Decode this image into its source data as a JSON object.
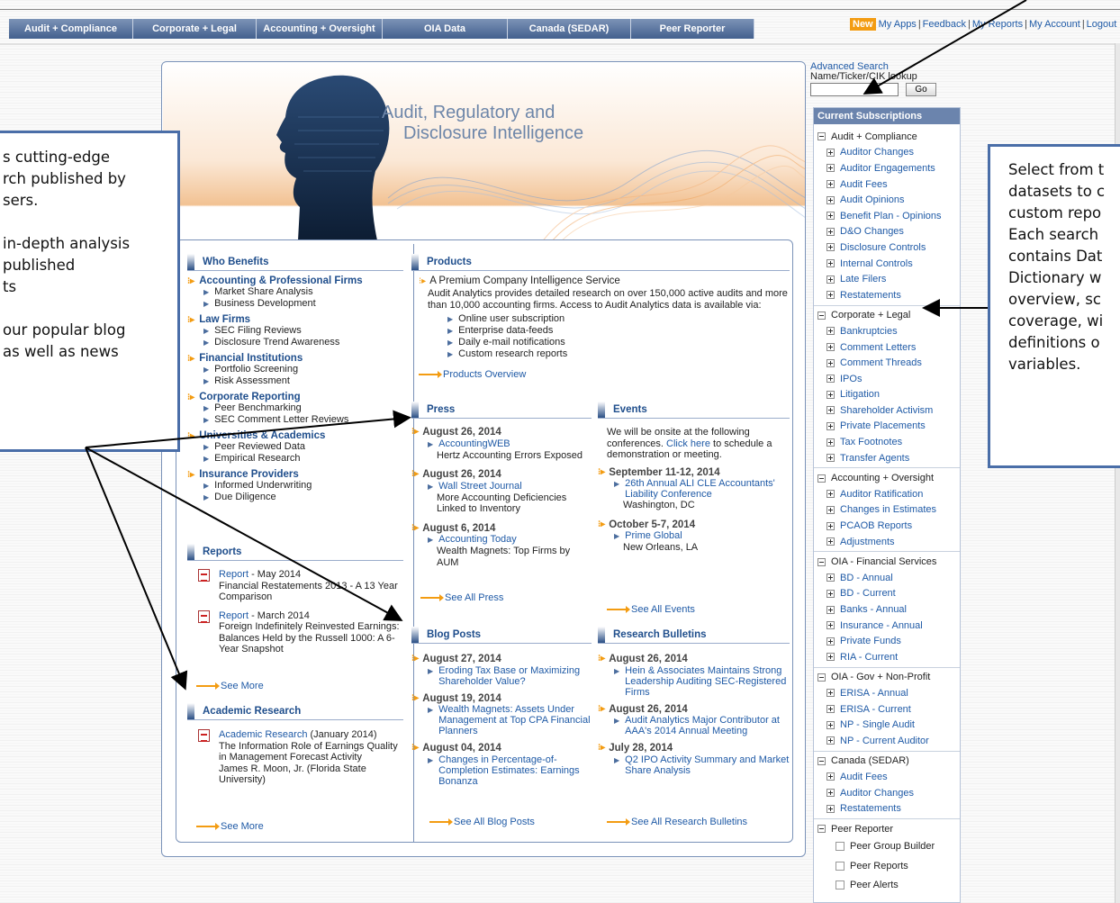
{
  "nav": {
    "tabs": [
      "Audit + Compliance",
      "Corporate + Legal",
      "Accounting + Oversight",
      "OIA Data",
      "Canada (SEDAR)",
      "Peer Reporter"
    ]
  },
  "toplinks": {
    "new_badge": "New",
    "my_apps": "My Apps",
    "feedback": "Feedback",
    "my_reports": "My Reports",
    "my_account": "My Account",
    "logout": "Logout",
    "separator": "|"
  },
  "hero": {
    "title_line1": "Audit, Regulatory and",
    "title_line2": "Disclosure Intelligence"
  },
  "search": {
    "advanced": "Advanced Search",
    "lookup_label": "Name/Ticker/CIK lookup",
    "input_value": "",
    "go": "Go"
  },
  "who_benefits": {
    "heading": "Who Benefits",
    "groups": [
      {
        "title": "Accounting & Professional Firms",
        "items": [
          "Market Share Analysis",
          "Business Development"
        ]
      },
      {
        "title": "Law Firms",
        "items": [
          "SEC Filing Reviews",
          "Disclosure Trend Awareness"
        ]
      },
      {
        "title": "Financial Institutions",
        "items": [
          "Portfolio Screening",
          "Risk Assessment"
        ]
      },
      {
        "title": "Corporate Reporting",
        "items": [
          "Peer Benchmarking",
          "SEC Comment Letter Reviews"
        ]
      },
      {
        "title": "Universities & Academics",
        "items": [
          "Peer Reviewed Data",
          "Empirical Research"
        ]
      },
      {
        "title": "Insurance Providers",
        "items": [
          "Informed Underwriting",
          "Due Diligence"
        ]
      }
    ]
  },
  "reports": {
    "heading": "Reports",
    "items": [
      {
        "link": "Report",
        "date": " - May 2014",
        "desc": "Financial Restatements 2013 - A 13 Year Comparison"
      },
      {
        "link": "Report",
        "date": " - March 2014",
        "desc": "Foreign Indefinitely Reinvested Earnings: Balances Held by the Russell 1000: A 6-Year Snapshot"
      }
    ],
    "see_more": "See More"
  },
  "academic": {
    "heading": "Academic Research",
    "link": "Academic Research",
    "date": " (January 2014)",
    "desc": "The Information Role of Earnings Quality in Management Forecast Activity",
    "author": "James R. Moon, Jr. (Florida State University)",
    "see_more": "See More"
  },
  "products": {
    "heading": "Products",
    "title": "A Premium Company Intelligence Service",
    "desc": "Audit Analytics provides detailed research on over 150,000 active audits and more than 10,000 accounting firms. Access to Audit Analytics data is available via:",
    "items": [
      "Online user subscription",
      "Enterprise data-feeds",
      "Daily e-mail notifications",
      "Custom research reports"
    ],
    "overview": "Products Overview"
  },
  "press": {
    "heading": "Press",
    "items": [
      {
        "date": "August 26, 2014",
        "source": "AccountingWEB",
        "desc": "Hertz Accounting Errors Exposed"
      },
      {
        "date": "August 26, 2014",
        "source": "Wall Street Journal",
        "desc": "More Accounting Deficiencies Linked to Inventory"
      },
      {
        "date": "August 6, 2014",
        "source": "Accounting Today",
        "desc": "Wealth Magnets: Top Firms by AUM"
      }
    ],
    "see_all": "See All Press"
  },
  "events": {
    "heading": "Events",
    "intro_a": "We will be onsite at the following conferences. ",
    "intro_link": "Click here",
    "intro_b": " to schedule a demonstration or meeting.",
    "items": [
      {
        "date": "September 11-12, 2014",
        "name": "26th Annual ALI CLE Accountants' Liability Conference",
        "place": "Washington, DC"
      },
      {
        "date": "October 5-7, 2014",
        "name": "Prime Global",
        "place": "New Orleans, LA"
      }
    ],
    "see_all": "See All Events"
  },
  "blog": {
    "heading": "Blog Posts",
    "items": [
      {
        "date": "August 27, 2014",
        "title": "Eroding Tax Base or Maximizing Shareholder Value?"
      },
      {
        "date": "August 19, 2014",
        "title": "Wealth Magnets: Assets Under Management at Top CPA Financial Planners"
      },
      {
        "date": "August 04, 2014",
        "title": "Changes in Percentage-of-Completion Estimates: Earnings Bonanza"
      }
    ],
    "see_all": "See All Blog Posts"
  },
  "bulletins": {
    "heading": "Research Bulletins",
    "items": [
      {
        "date": "August 26, 2014",
        "title": "Hein & Associates Maintains Strong Leadership Auditing SEC-Registered Firms"
      },
      {
        "date": "August 26, 2014",
        "title": "Audit Analytics Major Contributor at AAA's 2014 Annual Meeting"
      },
      {
        "date": "July 28, 2014",
        "title": "Q2 IPO Activity Summary and Market Share Analysis"
      }
    ],
    "see_all": "See All Research Bulletins"
  },
  "subscriptions": {
    "heading": "Current Subscriptions",
    "groups": [
      {
        "name": "Audit + Compliance",
        "items": [
          "Auditor Changes",
          "Auditor Engagements",
          "Audit Fees",
          "Audit Opinions",
          "Benefit Plan - Opinions",
          "D&O Changes",
          "Disclosure Controls",
          "Internal Controls",
          "Late Filers",
          "Restatements"
        ]
      },
      {
        "name": "Corporate + Legal",
        "items": [
          "Bankruptcies",
          "Comment Letters",
          "Comment Threads",
          "IPOs",
          "Litigation",
          "Shareholder Activism",
          "Private Placements",
          "Tax Footnotes",
          "Transfer Agents"
        ]
      },
      {
        "name": "Accounting + Oversight",
        "items": [
          "Auditor Ratification",
          "Changes in Estimates",
          "PCAOB Reports",
          "Adjustments"
        ]
      },
      {
        "name": "OIA - Financial Services",
        "items": [
          "BD - Annual",
          "BD - Current",
          "Banks - Annual",
          "Insurance - Annual",
          "Private Funds",
          "RIA - Current"
        ]
      },
      {
        "name": "OIA - Gov + Non-Profit",
        "items": [
          "ERISA - Annual",
          "ERISA - Current",
          "NP - Single Audit",
          "NP - Current Auditor"
        ]
      },
      {
        "name": "Canada (SEDAR)",
        "items": [
          "Audit Fees",
          "Auditor Changes",
          "Restatements"
        ]
      }
    ],
    "peer": {
      "name": "Peer Reporter",
      "items": [
        "Peer Group Builder",
        "Peer Reports",
        "Peer Alerts"
      ]
    }
  },
  "callout_left": {
    "lines": [
      "s cutting-edge",
      "rch published by",
      "sers.",
      "",
      "in-depth analysis",
      " published",
      "ts",
      "",
      "our popular blog",
      "as well as news"
    ]
  },
  "callout_right": {
    "lines": [
      "Select from t",
      "datasets to c",
      "custom repo",
      "Each search",
      "contains Dat",
      "Dictionary w",
      "overview, sc",
      "coverage, wi",
      "definitions o",
      "variables."
    ]
  },
  "colors": {
    "accent": "#f39c12",
    "nav": "#5a7299",
    "link": "#1f5aa6",
    "callout_border": "#4a6ea8"
  }
}
